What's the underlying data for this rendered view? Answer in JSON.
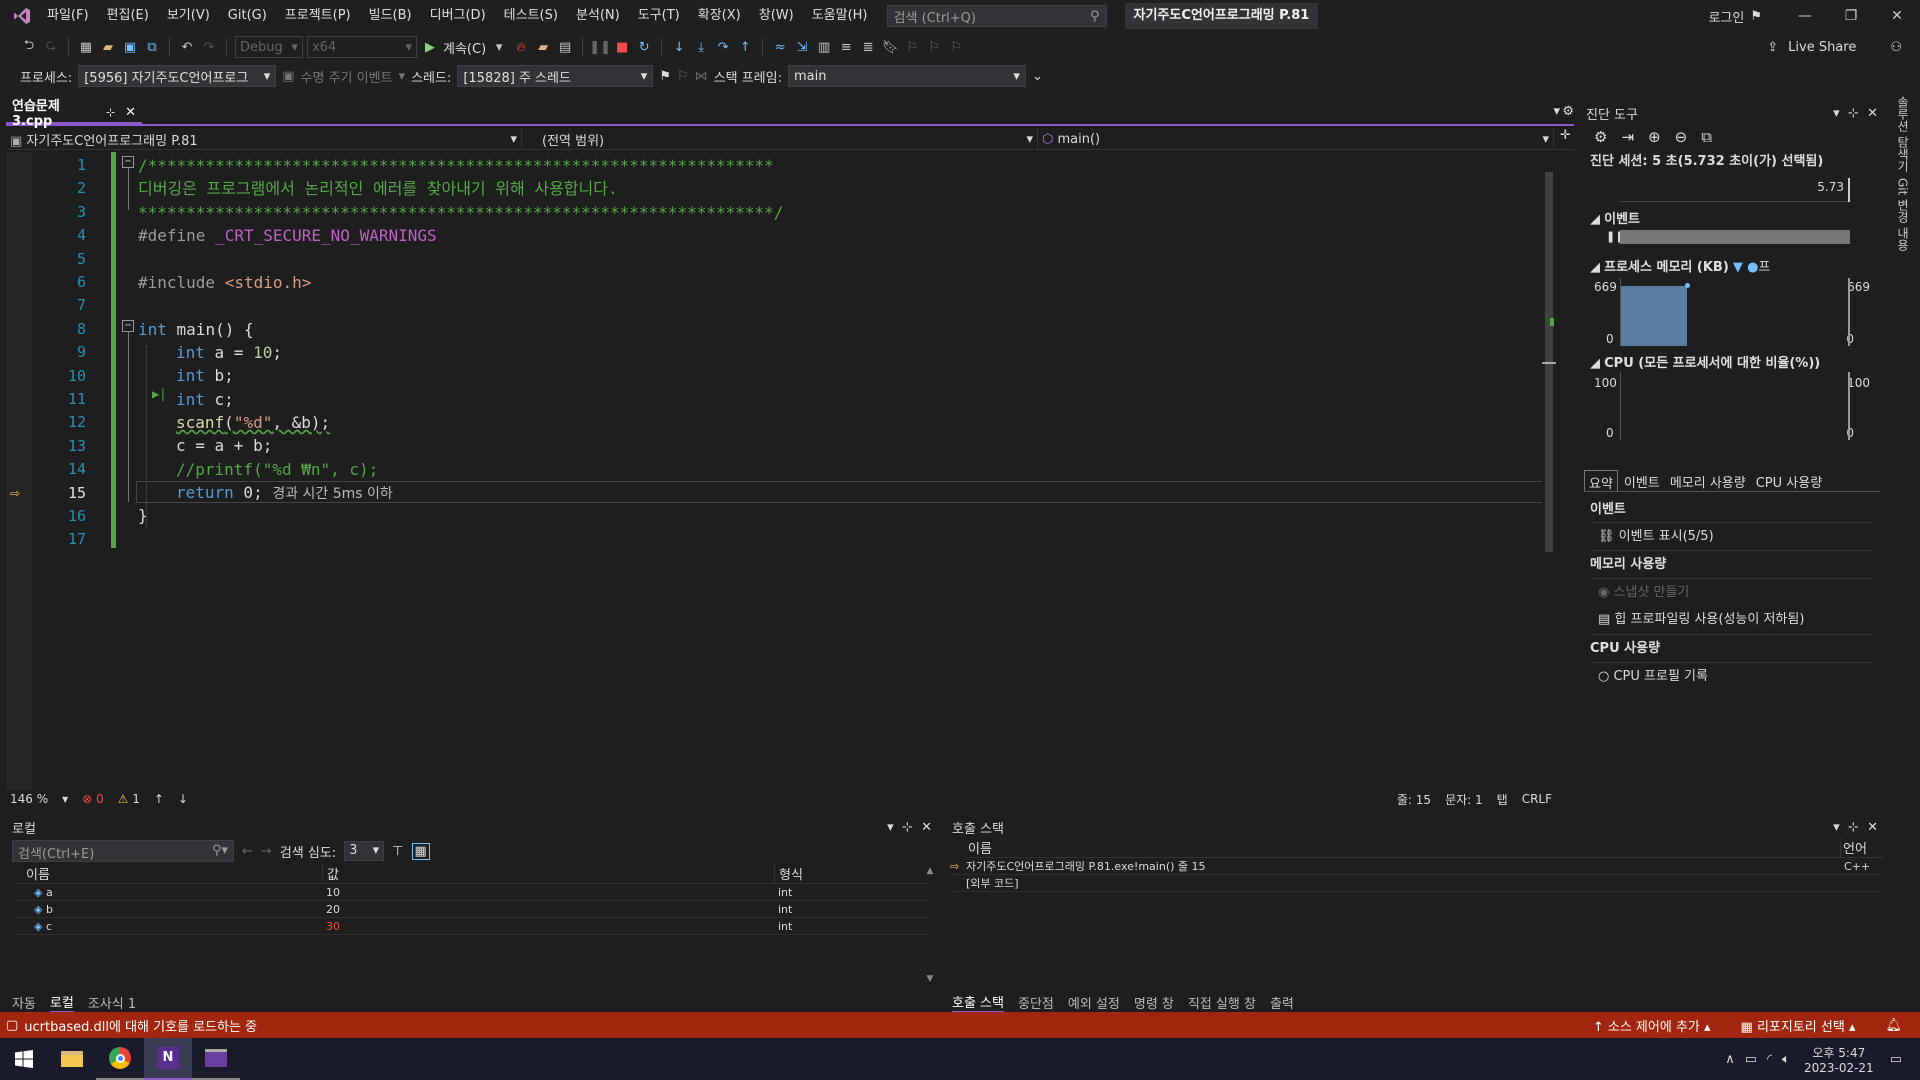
{
  "menu": {
    "items": [
      "파일(F)",
      "편집(E)",
      "보기(V)",
      "Git(G)",
      "프로젝트(P)",
      "빌드(B)",
      "디버그(D)",
      "테스트(S)",
      "분석(N)",
      "도구(T)",
      "확장(X)",
      "창(W)",
      "도움말(H)"
    ],
    "search_placeholder": "검색 (Ctrl+Q)",
    "solution_title": "자기주도C언어프로그래밍 P.81",
    "login": "로그인",
    "live_share": "Live Share"
  },
  "toolbar": {
    "config": "Debug",
    "platform": "x64",
    "continue": "계속(C)"
  },
  "debugbar": {
    "process_label": "프로세스:",
    "process_value": "[5956] 자기주도C언어프로그",
    "lifecycle": "수명 주기 이벤트",
    "thread_label": "스레드:",
    "thread_value": "[15828] 주 스레드",
    "stackframe_label": "스택 프레임:",
    "stackframe_value": "main"
  },
  "editor": {
    "tab": "연습문제3.cpp",
    "nav_project": "자기주도C언어프로그래밍 P.81",
    "nav_scope": "(전역 범위)",
    "nav_func": "main()",
    "lines": [
      "1",
      "2",
      "3",
      "4",
      "5",
      "6",
      "7",
      "8",
      "9",
      "10",
      "11",
      "12",
      "13",
      "14",
      "15",
      "16",
      "17"
    ],
    "code": {
      "l1": "/*****************************************************************",
      "l2": "디버깅은 프로그램에서 논리적인 에러를 찾아내기 위해 사용합니다.",
      "l3": "******************************************************************/",
      "l4a": "#define",
      "l4b": "_CRT_SECURE_NO_WARNINGS",
      "l6a": "#include",
      "l6b": "<stdio.h>",
      "l8a": "int",
      "l8b": " main() {",
      "l9a": "int",
      "l9b": " a = ",
      "l9c": "10",
      ";": ";",
      "l10a": "int",
      "l10b": " b;",
      "l11a": "int",
      "l11b": " c;",
      "l12a": "scanf",
      "l12b": "(",
      "l12c": "\"%d\"",
      "l12d": ", &b);",
      "l13": "c = a + b;",
      "l14": "//printf(\"%d ₩n\", c);",
      "l15a": "return",
      "l15b": " 0;",
      "l15c": "경과 시간 5ms 이하",
      "l16": "}"
    },
    "status": {
      "zoom": "146 %",
      "errors": "0",
      "warnings": "1",
      "line": "줄: 15",
      "char": "문자: 1",
      "tab": "탭",
      "eol": "CRLF"
    }
  },
  "diag": {
    "title": "진단 도구",
    "session": "진단 세션: 5 초(5.732 초이(가) 선택됨)",
    "ruler": "5.73",
    "events_label": "이벤트",
    "memory_label": "프로세스 메모리 (KB)",
    "mem_max": "669",
    "mem_min": "0",
    "mem_legend": "프",
    "cpu_label": "CPU (모든 프로세서에 대한 비율(%))",
    "cpu_max": "100",
    "cpu_min": "0",
    "tabs": [
      "요약",
      "이벤트",
      "메모리 사용량",
      "CPU 사용량"
    ],
    "sum_events": "이벤트",
    "show_events": "이벤트 표시(5/5)",
    "sum_memory": "메모리 사용량",
    "snapshot": "스냅샷 만들기",
    "heap": "힙 프로파일링 사용(성능이 저하됨)",
    "sum_cpu": "CPU 사용량",
    "cpu_record": "CPU 프로필 기록"
  },
  "locals": {
    "title": "로컬",
    "search_placeholder": "검색(Ctrl+E)",
    "depth_label": "검색 심도:",
    "depth": "3",
    "cols": [
      "이름",
      "값",
      "형식"
    ],
    "rows": [
      {
        "name": "a",
        "value": "10",
        "type": "int"
      },
      {
        "name": "b",
        "value": "20",
        "type": "int"
      },
      {
        "name": "c",
        "value": "30",
        "type": "int"
      }
    ],
    "tabs": [
      "자동",
      "로컬",
      "조사식 1"
    ]
  },
  "callstack": {
    "title": "호출 스택",
    "cols": [
      "이름",
      "언어"
    ],
    "rows": [
      {
        "name": "자기주도C언어프로그래밍 P.81.exe!main() 줄 15",
        "lang": "C++"
      },
      {
        "name": "[외부 코드]",
        "lang": ""
      }
    ],
    "tabs": [
      "호출 스택",
      "중단점",
      "예외 설정",
      "명령 창",
      "직접 실행 창",
      "출력"
    ]
  },
  "status": {
    "message": "ucrtbased.dll에 대해 기호를 로드하는 중",
    "source_control": "소스 제어에 추가",
    "repo": "리포지토리 선택"
  },
  "taskbar": {
    "time": "오후 5:47",
    "date": "2023-02-21"
  },
  "right_strip": [
    "솔루션 탐색기",
    "Git 변경 내용"
  ],
  "colors": {
    "accent": "#8a57cc",
    "status": "#a1260d",
    "comment": "#57a64a",
    "keyword": "#569cd6"
  }
}
